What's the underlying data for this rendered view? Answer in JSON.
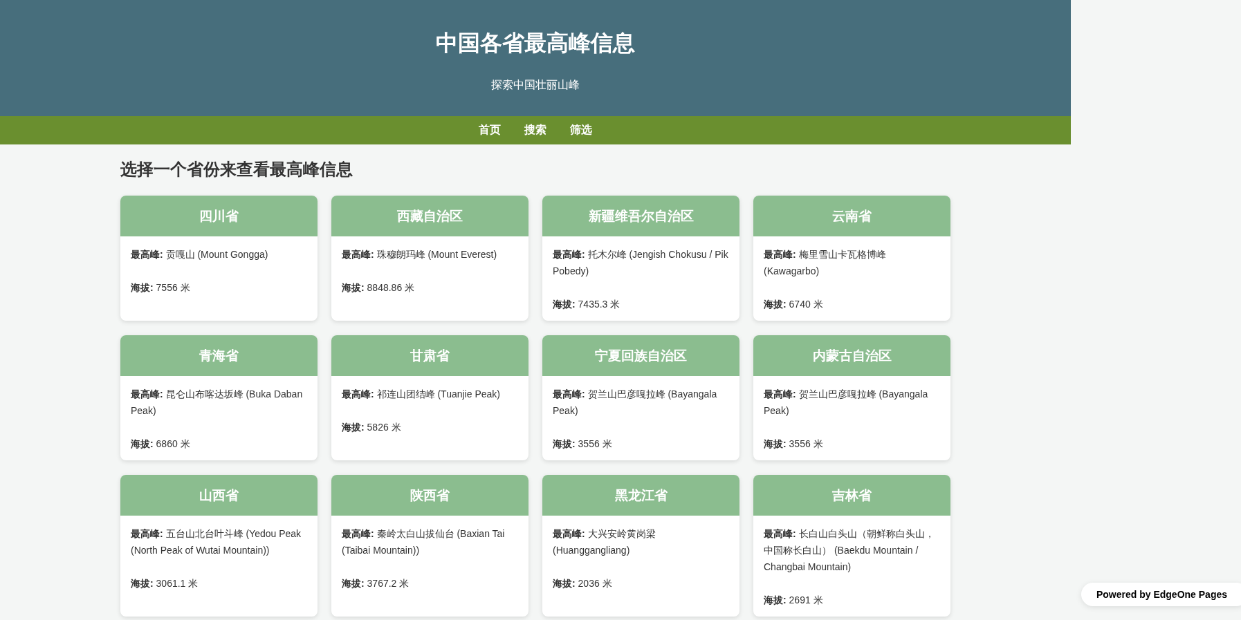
{
  "header": {
    "title": "中国各省最高峰信息",
    "subtitle": "探索中国壮丽山峰"
  },
  "nav": [
    "首页",
    "搜索",
    "筛选"
  ],
  "heading": "选择一个省份来查看最高峰信息",
  "provinces": [
    {
      "name": "四川省",
      "peak": "**最高峰:** 贡嘎山 (Mount Gongga)",
      "elevation": "**海拔:** 7556 米"
    },
    {
      "name": "西藏自治区",
      "peak": "**最高峰:** 珠穆朗玛峰 (Mount Everest)",
      "elevation": "**海拔:** 8848.86 米"
    },
    {
      "name": "新疆维吾尔自治区",
      "peak": "**最高峰:** 托木尔峰 (Jengish Chokusu / Pik Pobedy)",
      "elevation": "**海拔:** 7435.3 米"
    },
    {
      "name": "云南省",
      "peak": "**最高峰:** 梅里雪山卡瓦格博峰 (Kawagarbo)",
      "elevation": "**海拔:** 6740 米"
    },
    {
      "name": "青海省",
      "peak": "**最高峰:** 昆仑山布喀达坂峰 (Buka Daban Peak)",
      "elevation": "**海拔:** 6860 米"
    },
    {
      "name": "甘肃省",
      "peak": "**最高峰:** 祁连山团结峰 (Tuanjie Peak)",
      "elevation": "**海拔:** 5826 米"
    },
    {
      "name": "宁夏回族自治区",
      "peak": "**最高峰:** 贺兰山巴彦嘎拉峰 (Bayangala Peak)",
      "elevation": "**海拔:** 3556 米"
    },
    {
      "name": "内蒙古自治区",
      "peak": "**最高峰:** 贺兰山巴彦嘎拉峰 (Bayangala Peak)",
      "elevation": "**海拔:** 3556 米"
    },
    {
      "name": "山西省",
      "peak": "**最高峰:** 五台山北台叶斗峰 (Yedou Peak (North Peak of Wutai Mountain))",
      "elevation": "**海拔:** 3061.1 米"
    },
    {
      "name": "陕西省",
      "peak": "**最高峰:** 秦岭太白山拔仙台 (Baxian Tai (Taibai Mountain))",
      "elevation": "**海拔:** 3767.2 米"
    },
    {
      "name": "黑龙江省",
      "peak": "**最高峰:** 大兴安岭黄岗梁 (Huanggangliang)",
      "elevation": "**海拔:** 2036 米"
    },
    {
      "name": "吉林省",
      "peak": "**最高峰:** 长白山白头山（朝鲜称白头山，中国称长白山） (Baekdu Mountain / Changbai Mountain)",
      "elevation": "**海拔:** 2691 米"
    }
  ],
  "badge": "Powered by EdgeOne Pages"
}
